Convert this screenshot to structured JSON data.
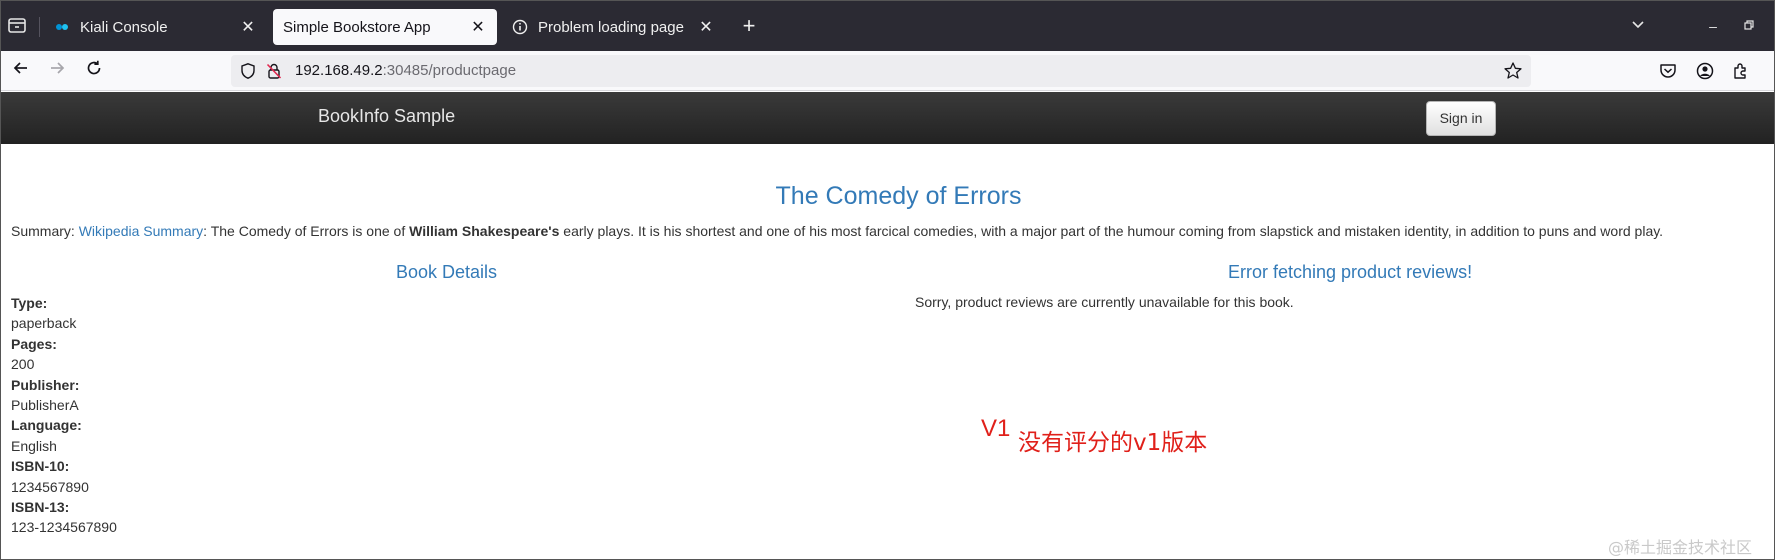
{
  "browser": {
    "tabs": [
      {
        "title": "Kiali Console",
        "icon": "kiali-favicon-icon"
      },
      {
        "title": "Simple Bookstore App",
        "icon": "none"
      },
      {
        "title": "Problem loading page",
        "icon": "info-icon"
      }
    ],
    "url_host": "192.168.49.2",
    "url_path": ":30485/productpage"
  },
  "header": {
    "brand": "BookInfo Sample",
    "sign_in": "Sign in"
  },
  "book": {
    "title": "The Comedy of Errors",
    "summary_prefix": "Summary: ",
    "summary_link": "Wikipedia Summary",
    "summary_text1": ": The Comedy of Errors is one of ",
    "summary_bold": "William Shakespeare's",
    "summary_text2": " early plays. It is his shortest and one of his most farcical comedies, with a major part of the humour coming from slapstick and mistaken identity, in addition to puns and word play."
  },
  "details": {
    "heading": "Book Details",
    "fields": [
      {
        "label": "Type:",
        "value": "paperback"
      },
      {
        "label": "Pages:",
        "value": "200"
      },
      {
        "label": "Publisher:",
        "value": "PublisherA"
      },
      {
        "label": "Language:",
        "value": "English"
      },
      {
        "label": "ISBN-10:",
        "value": "1234567890"
      },
      {
        "label": "ISBN-13:",
        "value": "123-1234567890"
      }
    ]
  },
  "reviews": {
    "heading": "Error fetching product reviews!",
    "message": "Sorry, product reviews are currently unavailable for this book."
  },
  "annotation": {
    "version": "V1",
    "note": "没有评分的v1版本"
  },
  "watermark": "@稀土掘金技术社区",
  "colors": {
    "link": "#337ab7",
    "annotation": "#e0201a",
    "header_bg": "#222222"
  }
}
